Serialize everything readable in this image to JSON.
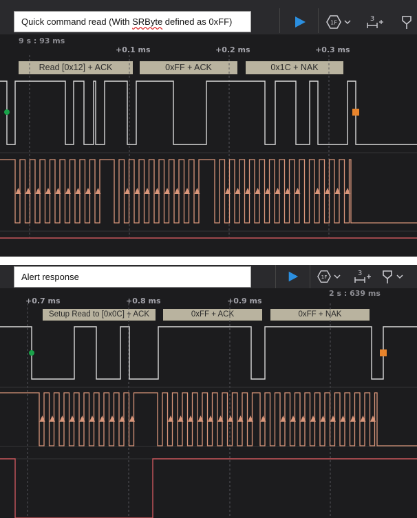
{
  "panels": [
    {
      "caption_pre": "Quick command read (With ",
      "caption_squiggle": "SRByte",
      "caption_post": " defined as 0xFF)",
      "abs_time": "9 s : 93 ms",
      "ticks": [
        "+0.1 ms",
        "+0.2 ms",
        "+0.3 ms"
      ],
      "decodes": [
        "Read [0x12] + ACK",
        "0xFF + ACK",
        "0x1C + NAK"
      ],
      "toolbar": {
        "trigger_icon": "1F",
        "measure_num": "3"
      },
      "colors": {
        "scl": "#d9d9d9",
        "sda": "#d9967a",
        "start_marker": "#1aa34a",
        "stop_marker": "#e8842c",
        "alert": "#c8565c"
      }
    },
    {
      "caption": "Alert response",
      "abs_time": "2 s : 639 ms",
      "ticks": [
        "+0.7 ms",
        "+0.8 ms",
        "+0.9 ms"
      ],
      "decodes": [
        "Setup Read to [0x0C] + ACK",
        "0xFF + ACK",
        "0xFF + NAK"
      ],
      "toolbar": {
        "trigger_icon": "1F",
        "measure_num": "3"
      },
      "colors": {
        "scl": "#d9d9d9",
        "sda": "#d9967a",
        "start_marker": "#1aa34a",
        "stop_marker": "#e8842c",
        "alert": "#c8565c"
      }
    }
  ]
}
